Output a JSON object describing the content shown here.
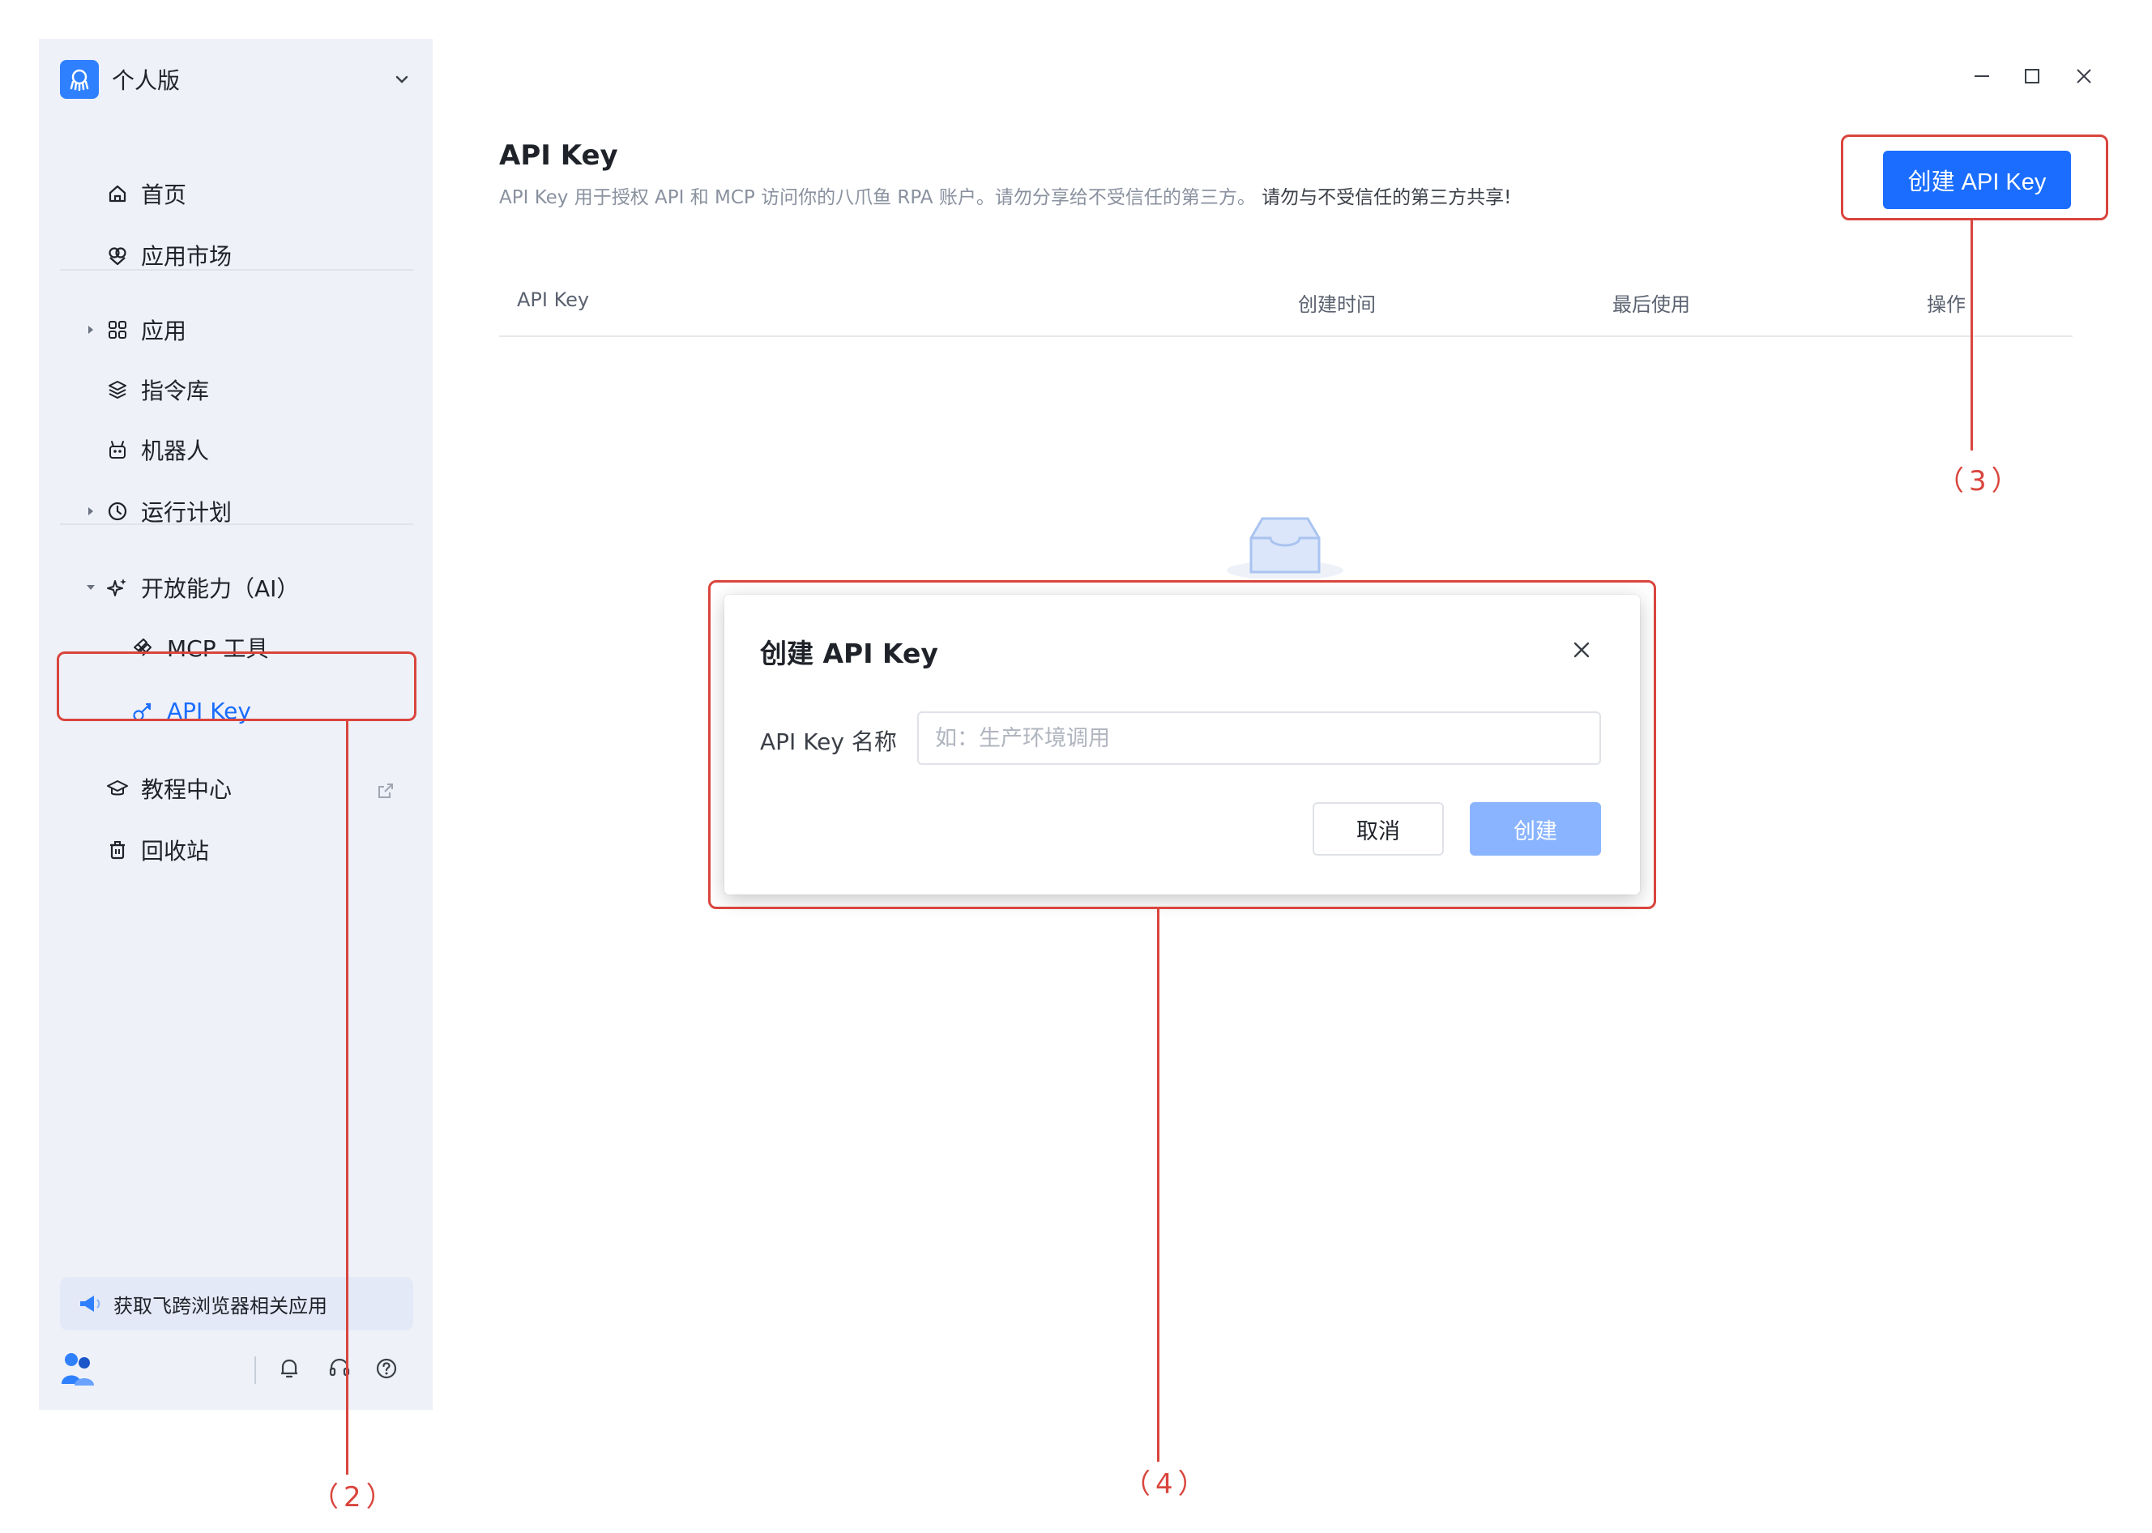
{
  "sidebar": {
    "workspace": "个人版",
    "items": [
      {
        "label": "首页",
        "icon": "home-icon"
      },
      {
        "label": "应用市场",
        "icon": "market-icon"
      },
      {
        "label": "应用",
        "icon": "apps-grid-icon"
      },
      {
        "label": "指令库",
        "icon": "layers-icon"
      },
      {
        "label": "机器人",
        "icon": "robot-icon"
      },
      {
        "label": "运行计划",
        "icon": "clock-icon"
      },
      {
        "label": "开放能力（AI）",
        "icon": "sparkle-icon"
      },
      {
        "label": "MCP 工具",
        "icon": "mcp-icon"
      },
      {
        "label": "API Key",
        "icon": "key-icon"
      },
      {
        "label": "教程中心",
        "icon": "graduation-cap-icon"
      },
      {
        "label": "回收站",
        "icon": "trash-icon"
      }
    ],
    "promo": "获取飞跨浏览器相关应用"
  },
  "page": {
    "title": "API Key",
    "description": "API Key 用于授权 API 和 MCP 访问你的八爪鱼 RPA 账户。请勿分享给不受信任的第三方。",
    "warning": "请勿与不受信任的第三方共享!",
    "create_button": "创建 API Key"
  },
  "table": {
    "columns": [
      "API Key",
      "创建时间",
      "最后使用",
      "操作"
    ]
  },
  "modal": {
    "title": "创建 API Key",
    "field_label": "API Key 名称",
    "field_placeholder": "如：生产环境调用",
    "field_value": "",
    "cancel": "取消",
    "confirm": "创建"
  },
  "annotations": [
    "（2）",
    "（3）",
    "（4）"
  ],
  "colors": {
    "accent": "#1a6dff",
    "sidebar_bg": "#eef1f8",
    "annotation": "#d9453d",
    "disabled_button": "#8ab4ff"
  }
}
